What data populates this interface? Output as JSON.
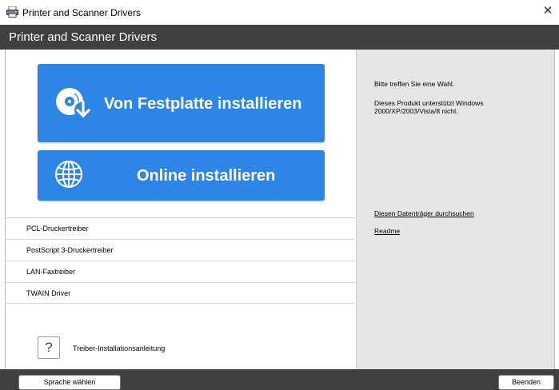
{
  "window": {
    "title": "Printer and Scanner Drivers",
    "close_glyph": "✕",
    "app_icon": "printer-icon"
  },
  "header": {
    "title": "Printer and Scanner Drivers"
  },
  "main": {
    "install_local_label": "Von Festplatte installieren",
    "install_local_icon": "disc-download-icon",
    "install_online_label": "Online installieren",
    "install_online_icon": "globe-icon",
    "accent_color": "#2d86e6",
    "drivers": [
      "PCL-Druckertreiber",
      "PostScript 3-Druckertreiber",
      "LAN-Faxtreiber",
      "TWAIN Driver"
    ],
    "guide_glyph": "?",
    "guide_label": "Treiber-Installationsanleitung"
  },
  "sidebar": {
    "prompt": "Bitte treffen Sie eine Wahl.",
    "support_note": "Dieses Produkt unterstützt Windows 2000/XP/2003/Vista/8 nicht.",
    "browse_link": "Diesen Datenträger durchsuchen",
    "readme_link": "Readme"
  },
  "footer": {
    "language_button": "Sprache wählen",
    "exit_button": "Beenden"
  }
}
